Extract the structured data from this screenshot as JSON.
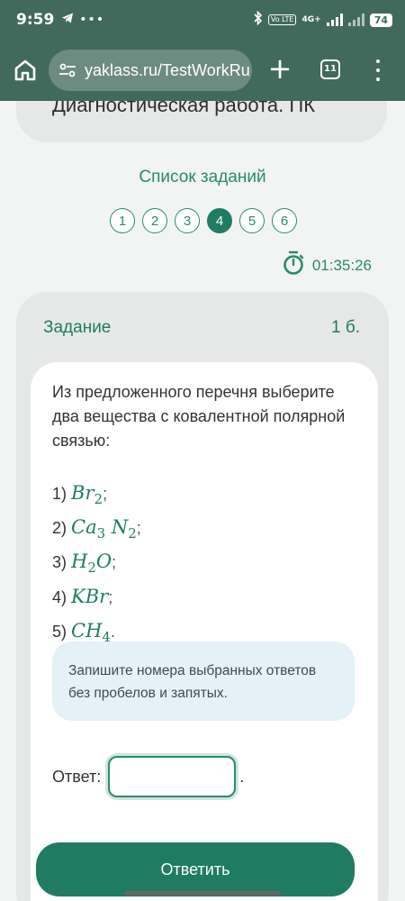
{
  "status_bar": {
    "time": "9:59",
    "dots": "•••",
    "network": "4G+",
    "volte": "Vo LTE",
    "battery": "74"
  },
  "browser": {
    "url": "yaklass.ru/TestWorkRu",
    "tab_count": "11"
  },
  "page": {
    "title": "Диагностическая работа. ПК",
    "task_list_title": "Список заданий",
    "pages": [
      "1",
      "2",
      "3",
      "4",
      "5",
      "6"
    ],
    "active_page": "4",
    "timer": "01:35:26"
  },
  "task": {
    "heading": "Задание",
    "score": "1 б.",
    "question": "Из предложенного перечня выберите два вещества с ковалентной полярной связью:",
    "options": [
      {
        "num": "1)",
        "parts": [
          [
            "Br",
            ""
          ],
          [
            "",
            "2"
          ]
        ],
        "end": ";"
      },
      {
        "num": "2)",
        "parts": [
          [
            "Ca",
            "3"
          ],
          [
            "N",
            "2"
          ]
        ],
        "end": ";"
      },
      {
        "num": "3)",
        "parts": [
          [
            "H",
            "2"
          ],
          [
            "O",
            ""
          ]
        ],
        "end": ";"
      },
      {
        "num": "4)",
        "parts": [
          [
            "KBr",
            ""
          ]
        ],
        "end": ";"
      },
      {
        "num": "5)",
        "parts": [
          [
            "CH",
            "4"
          ]
        ],
        "end": "."
      }
    ],
    "hint": "Запишите номера выбранных ответов без пробелов и запятых.",
    "answer_label": "Ответ:",
    "answer_value": "",
    "answer_end": ".",
    "submit_label": "Ответить"
  },
  "colors": {
    "accent": "#1f7c62",
    "toolbar": "#426a5c",
    "hint_bg": "#e4f1f7"
  }
}
